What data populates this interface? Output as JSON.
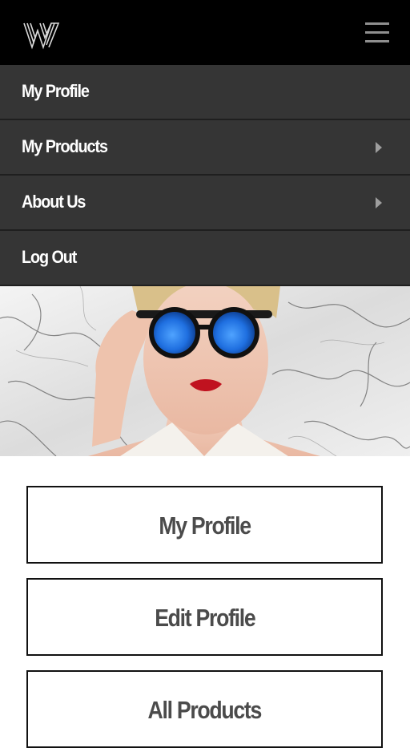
{
  "header": {
    "logo_text": "W",
    "menu_icon": "hamburger-menu-icon"
  },
  "menu": {
    "items": [
      {
        "label": "My Profile",
        "has_chevron": false
      },
      {
        "label": "My Products",
        "has_chevron": true
      },
      {
        "label": "About Us",
        "has_chevron": true
      },
      {
        "label": "Log Out",
        "has_chevron": false
      }
    ]
  },
  "hero": {
    "image": "woman-in-blue-mirrored-sunglasses-on-marble-background"
  },
  "actions": {
    "my_profile": "My Profile",
    "edit_profile": "Edit Profile",
    "all_products": "All Products"
  },
  "colors": {
    "topbar": "#000000",
    "menu_bg": "#353535",
    "menu_text": "#ffffff",
    "button_text": "#4b4b4b",
    "lens_blue": "#1f6fe0"
  }
}
